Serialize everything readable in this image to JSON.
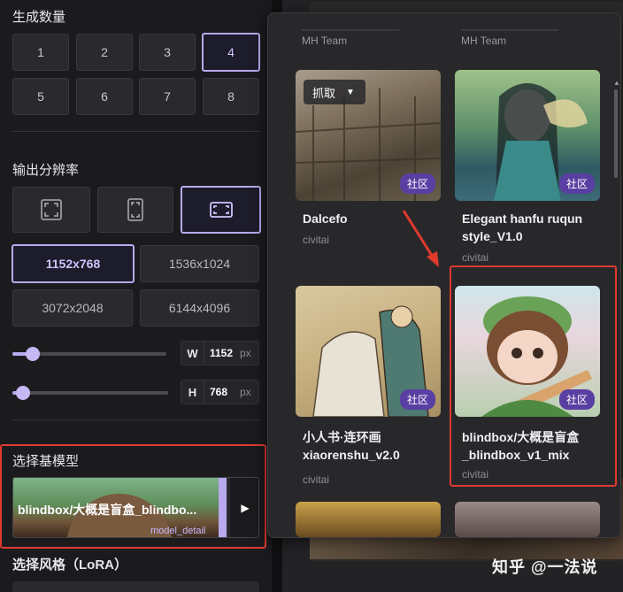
{
  "count_section": {
    "title": "生成数量",
    "options": [
      "1",
      "2",
      "3",
      "4",
      "5",
      "6",
      "7",
      "8"
    ],
    "selected": "4"
  },
  "resolution_section": {
    "title": "输出分辨率",
    "ratio_icons": [
      "square-ratio-icon",
      "portrait-ratio-icon",
      "landscape-ratio-icon"
    ],
    "selected_ratio": "landscape",
    "sizes": [
      "1152x768",
      "1536x1024",
      "3072x2048",
      "6144x4096"
    ],
    "selected_size": "1152x768",
    "width": {
      "label": "W",
      "value": "1152",
      "unit": "px"
    },
    "height": {
      "label": "H",
      "value": "768",
      "unit": "px"
    }
  },
  "base_model_section": {
    "title": "选择基模型",
    "model_name": "blindbox/大概是盲盒_blindbo...",
    "model_sub": "model_detail"
  },
  "lora_section": {
    "title": "选择风格（LoRA）"
  },
  "popup": {
    "team_left": "MH Team",
    "team_right": "MH Team",
    "grab_label": "抓取",
    "cards": [
      {
        "title": "Dalcefo",
        "source": "civitai",
        "badge": "社区"
      },
      {
        "title": "Elegant hanfu ruqun style_V1.0",
        "source": "civitai",
        "badge": "社区"
      },
      {
        "title": "小人书·连环画 xiaorenshu_v2.0",
        "source": "civitai",
        "badge": "社区"
      },
      {
        "title": "blindbox/大概是盲盒_blindbox_v1_mix",
        "source": "civitai",
        "badge": "社区"
      }
    ]
  },
  "watermark": "知乎 @一法说",
  "colors": {
    "accent": "#b9a9ee",
    "badge": "#5a3fa3",
    "highlight": "#e03a2f"
  }
}
